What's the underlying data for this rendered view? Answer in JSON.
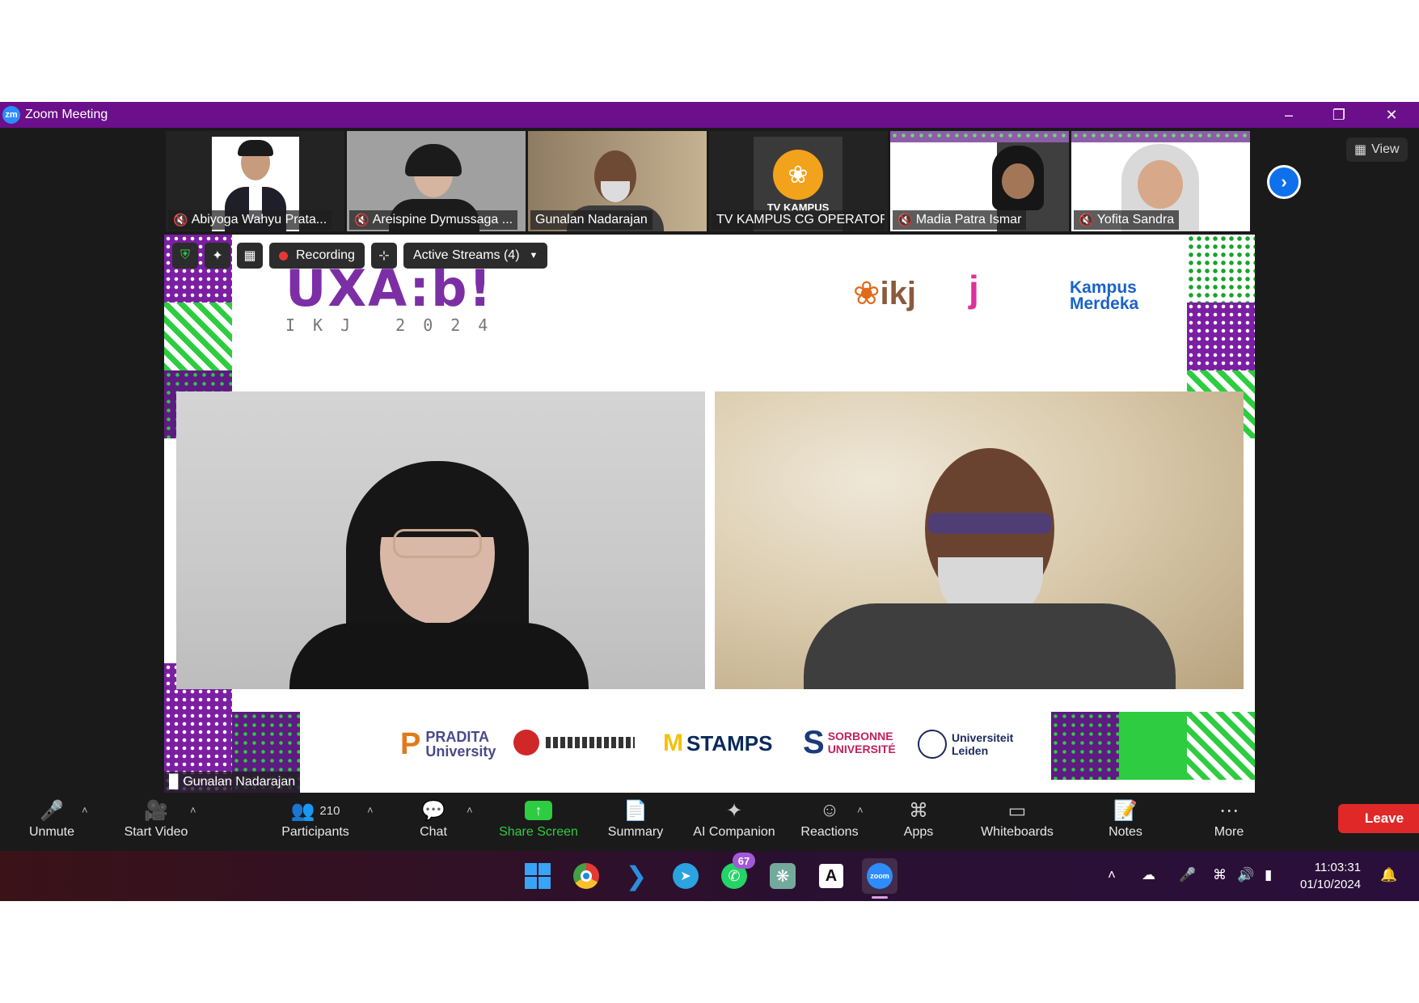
{
  "window": {
    "title": "Zoom Meeting",
    "app_icon_text": "zm"
  },
  "participants": [
    {
      "name": "Abiyoga Wahyu Prata...",
      "muted": true
    },
    {
      "name": "Areispine Dymussaga ...",
      "muted": true
    },
    {
      "name": "Gunalan Nadarajan",
      "muted": false
    },
    {
      "name": "TV KAMPUS CG OPERATOR",
      "muted": false,
      "avatar_text": "TV KAMPUS"
    },
    {
      "name": "Madia Patra Ismar",
      "muted": true
    },
    {
      "name": "Yofita Sandra",
      "muted": true
    }
  ],
  "view_button": "View",
  "stage": {
    "toolbar": {
      "recording_label": "Recording",
      "streams_label": "Active Streams (4)"
    },
    "event_logo": {
      "main": "UXA:b!",
      "sub": "IKJ 2024"
    },
    "top_logos": [
      "ikj",
      "Kampus Merdeka"
    ],
    "bottom_logos": [
      "PRADITA University",
      "STAMPS",
      "SORBONNE UNIVERSITÉ",
      "Universiteit Leiden"
    ],
    "speaker_name": "Gunalan Nadarajan"
  },
  "controls": {
    "unmute": "Unmute",
    "start_video": "Start Video",
    "participants": "Participants",
    "participants_count": "210",
    "chat": "Chat",
    "share_screen": "Share Screen",
    "summary": "Summary",
    "ai_companion": "AI Companion",
    "reactions": "Reactions",
    "apps": "Apps",
    "whiteboards": "Whiteboards",
    "notes": "Notes",
    "more": "More",
    "leave": "Leave"
  },
  "taskbar": {
    "whatsapp_badge": "67",
    "zoom_label": "zoom",
    "time": "11:03:31",
    "date": "01/10/2024"
  },
  "colors": {
    "titlebar": "#6b0f8a",
    "share_green": "#2ecc40",
    "leave_red": "#e02828",
    "accent_blue": "#0e71eb"
  }
}
